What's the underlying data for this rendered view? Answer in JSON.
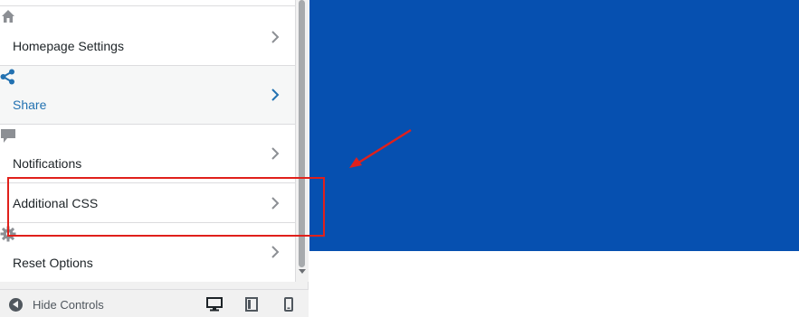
{
  "sidebar": {
    "sections": [
      {
        "label": "Homepage Settings",
        "icon": "home-icon"
      },
      {
        "label": "Share",
        "icon": "share-icon"
      },
      {
        "label": "Notifications",
        "icon": "comment-icon"
      },
      {
        "label": "Additional CSS",
        "icon": ""
      },
      {
        "label": "Reset Options",
        "icon": "gear-icon"
      }
    ]
  },
  "footer": {
    "hide_controls_label": "Hide Controls",
    "devices": [
      "desktop-icon",
      "tablet-icon",
      "mobile-icon"
    ]
  },
  "colors": {
    "preview_background": "#0650b0",
    "highlight": "#e0201b",
    "active_label": "#2271b1"
  }
}
